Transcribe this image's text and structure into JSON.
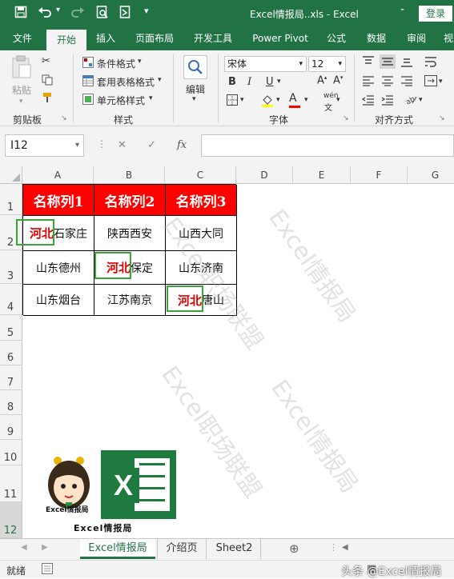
{
  "window": {
    "title": "Excel情报局..xls  -  Excel",
    "login_label": "登录",
    "quick_access": [
      "save-icon",
      "undo-icon",
      "redo-icon",
      "print-preview-icon",
      "open-icon",
      "customize-icon"
    ]
  },
  "ribbon_tabs": [
    "文件",
    "开始",
    "插入",
    "页面布局",
    "开发工具",
    "Power Pivot",
    "公式",
    "数据",
    "审阅",
    "视"
  ],
  "ribbon": {
    "paste_label": "粘贴",
    "clipboard_label": "剪贴板",
    "conditional_format": "条件格式",
    "format_as_table": "套用表格格式",
    "cell_styles": "单元格样式",
    "styles_label": "样式",
    "edit_label": "编辑",
    "font_name": "宋体",
    "font_size": "12",
    "bold": "B",
    "italic": "I",
    "underline": "U",
    "font_color_letter": "A",
    "phonetic": "wén",
    "font_group_label": "字体",
    "align_group_label": "对齐方式",
    "accent_red": "#ff0000",
    "accent_yellow": "#ffff00"
  },
  "formula_bar": {
    "name_box": "I12",
    "fx": "fx",
    "formula": ""
  },
  "columns": [
    "A",
    "B",
    "C",
    "D",
    "E",
    "F",
    "G"
  ],
  "rows": [
    "1",
    "2",
    "3",
    "4",
    "5",
    "6",
    "7",
    "8",
    "9",
    "10",
    "11",
    "12"
  ],
  "table": {
    "header": [
      "名称列1",
      "名称列2",
      "名称列3"
    ],
    "rows": [
      [
        {
          "red": "河北",
          "rest": "石家庄"
        },
        {
          "red": "",
          "rest": "陕西西安"
        },
        {
          "red": "",
          "rest": "山西大同"
        }
      ],
      [
        {
          "red": "",
          "rest": "山东德州"
        },
        {
          "red": "河北",
          "rest": "保定"
        },
        {
          "red": "",
          "rest": "山东济南"
        }
      ],
      [
        {
          "red": "",
          "rest": "山东烟台"
        },
        {
          "red": "",
          "rest": "江苏南京"
        },
        {
          "red": "河北",
          "rest": "唐山"
        }
      ]
    ],
    "header_color": "#ff0000",
    "highlight_color": "#3aa33a"
  },
  "watermarks": [
    "Excel情报局",
    "Excel职场联盟",
    "Excel职场联盟",
    "Excel情报局"
  ],
  "logo": {
    "avatar_caption": "Excel情报局",
    "brand_caption": "Excel情报局",
    "letter": "X"
  },
  "sheet_tabs": [
    "Excel情报局",
    "介绍页",
    "Sheet2"
  ],
  "active_sheet": "Excel情报局",
  "status": {
    "ready": "就绪",
    "credit": "头条 @Excel情报局"
  }
}
